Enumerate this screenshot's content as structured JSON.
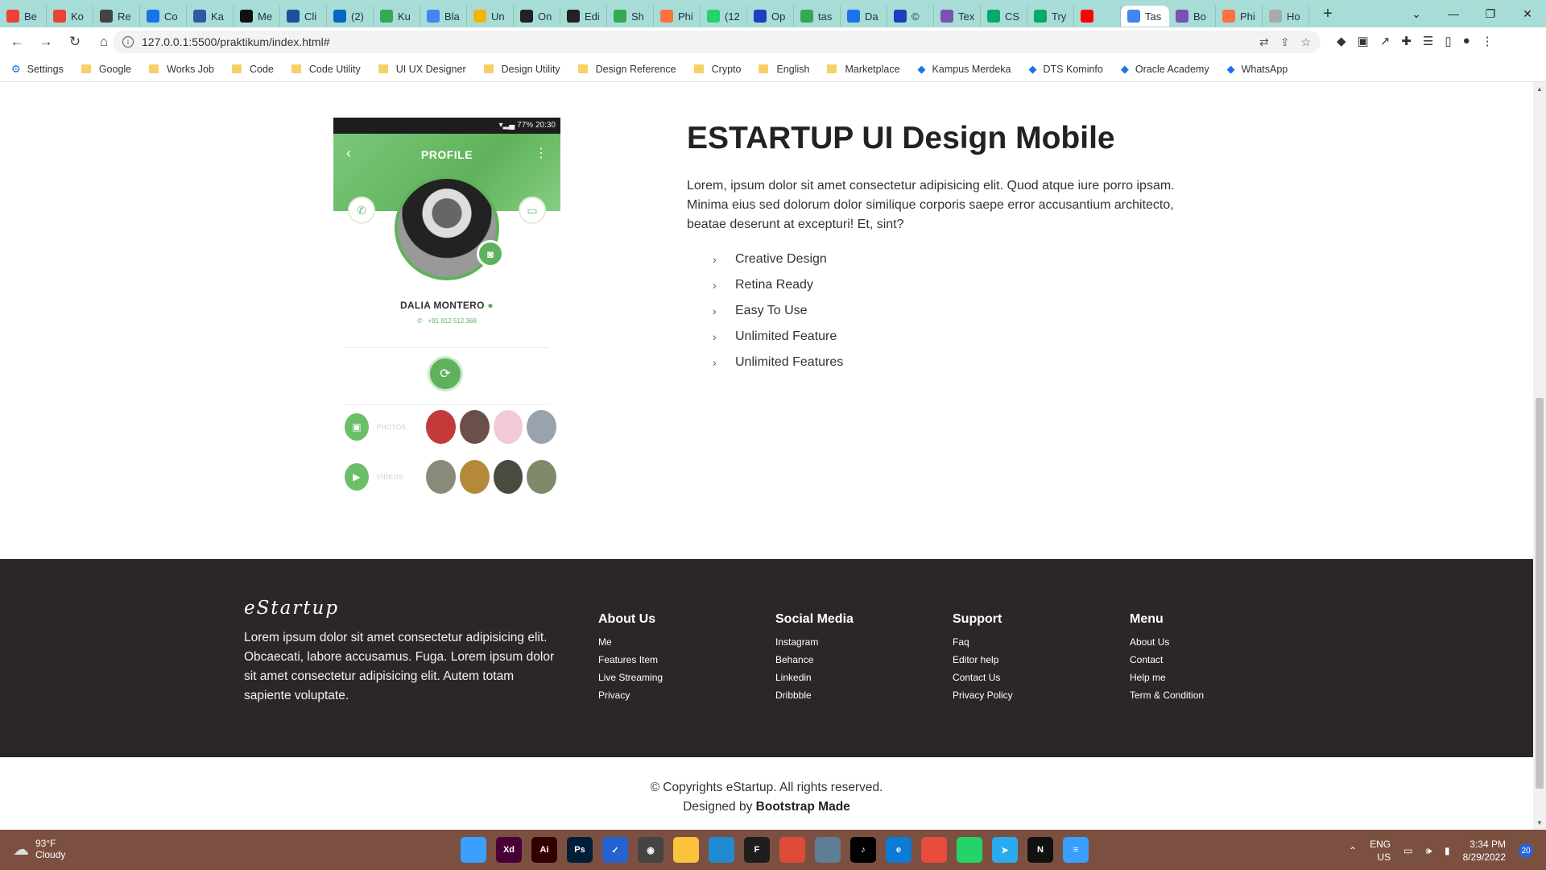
{
  "browser": {
    "tabs": [
      {
        "label": "Be",
        "color": "#ea4335"
      },
      {
        "label": "Ko",
        "color": "#ea4335"
      },
      {
        "label": "Re",
        "color": "#444444"
      },
      {
        "label": "Co",
        "color": "#1a73e8"
      },
      {
        "label": "Ka",
        "color": "#2d5aa7"
      },
      {
        "label": "Me",
        "color": "#111111"
      },
      {
        "label": "Cli",
        "color": "#1b4f9c"
      },
      {
        "label": "(2)",
        "color": "#0a66c2"
      },
      {
        "label": "Ku",
        "color": "#34a853"
      },
      {
        "label": "Bla",
        "color": "#4285f4"
      },
      {
        "label": "Un",
        "color": "#f4b400"
      },
      {
        "label": "On",
        "color": "#222222"
      },
      {
        "label": "Edi",
        "color": "#222222"
      },
      {
        "label": "Sh",
        "color": "#34a853"
      },
      {
        "label": "Phi",
        "color": "#ff7043"
      },
      {
        "label": "(12",
        "color": "#25d366"
      },
      {
        "label": "Op",
        "color": "#1a3fbf"
      },
      {
        "label": "tas",
        "color": "#34a853"
      },
      {
        "label": "Da",
        "color": "#1a73e8"
      },
      {
        "label": "©",
        "color": "#1a3fbf"
      },
      {
        "label": "Tex",
        "color": "#7952b3"
      },
      {
        "label": "CS",
        "color": "#04aa6d"
      },
      {
        "label": "Try",
        "color": "#04aa6d"
      },
      {
        "label": "",
        "color": "#ff0000"
      },
      {
        "label": "Tas",
        "color": "#4285f4"
      },
      {
        "label": "Bo",
        "color": "#7952b3"
      },
      {
        "label": "Phi",
        "color": "#ff7043"
      },
      {
        "label": "Ho",
        "color": "#aaaaaa"
      }
    ],
    "active_tab_index": 24,
    "url": "127.0.0.1:5500/praktikum/index.html#",
    "bookmarks": [
      {
        "label": "Settings",
        "icon": "gear-icon"
      },
      {
        "label": "Google",
        "icon": "folder-icon"
      },
      {
        "label": "Works Job",
        "icon": "folder-icon"
      },
      {
        "label": "Code",
        "icon": "folder-icon"
      },
      {
        "label": "Code Utility",
        "icon": "folder-icon"
      },
      {
        "label": "UI UX Designer",
        "icon": "folder-icon"
      },
      {
        "label": "Design Utility",
        "icon": "folder-icon"
      },
      {
        "label": "Design Reference",
        "icon": "folder-icon"
      },
      {
        "label": "Crypto",
        "icon": "folder-icon"
      },
      {
        "label": "English",
        "icon": "folder-icon"
      },
      {
        "label": "Marketplace",
        "icon": "folder-icon"
      },
      {
        "label": "Kampus Merdeka",
        "icon": "kampus-icon"
      },
      {
        "label": "DTS Kominfo",
        "icon": "dts-icon"
      },
      {
        "label": "Oracle Academy",
        "icon": "oracle-icon"
      },
      {
        "label": "WhatsApp",
        "icon": "whatsapp-icon"
      }
    ]
  },
  "phone_mockup": {
    "status_time": "20:30",
    "status_battery": "77%",
    "header_title": "PROFILE",
    "name": "DALIA MONTERO",
    "phone_number": "+91 912 512 368",
    "photos_label": "PHOTOS",
    "videos_label": "VIDEOS"
  },
  "hero": {
    "title": "ESTARTUP UI Design Mobile",
    "text": "Lorem, ipsum dolor sit amet consectetur adipisicing elit. Quod atque iure porro ipsam. Minima eius sed dolorum dolor similique corporis saepe error accusantium architecto, beatae deserunt at excepturi! Et, sint?",
    "features": [
      "Creative Design",
      "Retina Ready",
      "Easy To Use",
      "Unlimited Feature",
      "Unlimited Features"
    ]
  },
  "footer": {
    "brand": "eStartup",
    "description": "Lorem ipsum dolor sit amet consectetur adipisicing elit. Obcaecati, labore accusamus. Fuga. Lorem ipsum dolor sit amet consectetur adipisicing elit. Autem totam sapiente voluptate.",
    "columns": [
      {
        "title": "About Us",
        "links": [
          "Me",
          "Features Item",
          "Live Streaming",
          "Privacy"
        ]
      },
      {
        "title": "Social Media",
        "links": [
          "Instagram",
          "Behance",
          "Linkedin",
          "Dribbble"
        ]
      },
      {
        "title": "Support",
        "links": [
          "Faq",
          "Editor help",
          "Contact Us",
          "Privacy Policy"
        ]
      },
      {
        "title": "Menu",
        "links": [
          "About Us",
          "Contact",
          "Help me",
          "Term & Condition"
        ]
      }
    ]
  },
  "copyright": {
    "line1": "© Copyrights eStartup. All rights reserved.",
    "line2_prefix": "Designed by ",
    "line2_link": "Bootstrap Made"
  },
  "taskbar": {
    "weather_temp": "93°F",
    "weather_desc": "Cloudy",
    "lang": "ENG",
    "region": "US",
    "time": "3:34 PM",
    "date": "8/29/2022",
    "notifications": "20",
    "apps": [
      {
        "name": "windows-start-icon",
        "label": "",
        "color": "#3aa0ff"
      },
      {
        "name": "adobe-xd-icon",
        "label": "Xd",
        "color": "#470137"
      },
      {
        "name": "adobe-illustrator-icon",
        "label": "Ai",
        "color": "#330000"
      },
      {
        "name": "adobe-photoshop-icon",
        "label": "Ps",
        "color": "#001e36"
      },
      {
        "name": "todo-icon",
        "label": "✓",
        "color": "#2564cf"
      },
      {
        "name": "camera-app-icon",
        "label": "◉",
        "color": "#444444"
      },
      {
        "name": "file-explorer-icon",
        "label": "",
        "color": "#f9c33c"
      },
      {
        "name": "vscode-icon",
        "label": "",
        "color": "#1f8ad2"
      },
      {
        "name": "figma-icon",
        "label": "F",
        "color": "#1e1e1e"
      },
      {
        "name": "chrome-icon",
        "label": "",
        "color": "#dd4b39"
      },
      {
        "name": "photos-icon",
        "label": "",
        "color": "#5f7d95"
      },
      {
        "name": "tiktok-icon",
        "label": "♪",
        "color": "#000000"
      },
      {
        "name": "edge-icon",
        "label": "e",
        "color": "#0c7bd6"
      },
      {
        "name": "office-icon",
        "label": "",
        "color": "#e74c3c"
      },
      {
        "name": "whatsapp-icon",
        "label": "",
        "color": "#25d366"
      },
      {
        "name": "telegram-icon",
        "label": "➤",
        "color": "#2aabee"
      },
      {
        "name": "notion-icon",
        "label": "N",
        "color": "#111111"
      },
      {
        "name": "notepad-icon",
        "label": "≡",
        "color": "#3aa0ff"
      }
    ]
  }
}
